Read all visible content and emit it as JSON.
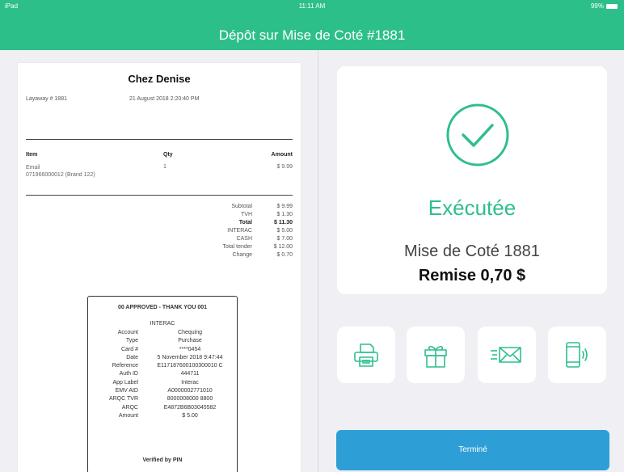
{
  "status_bar": {
    "device": "iPad",
    "time": "11:11 AM",
    "battery": "99%"
  },
  "header": {
    "title": "Dépôt sur Mise de Coté #1881"
  },
  "receipt": {
    "store": "Chez Denise",
    "layaway": "Layaway # 1881",
    "datetime": "21 August 2018 2:20:40 PM",
    "columns": {
      "item": "Item",
      "qty": "Qty",
      "amount": "Amount"
    },
    "item": {
      "name": "Email",
      "sku": "071966000012 (Brand 122)",
      "qty": "1",
      "amount": "$ 9.99"
    },
    "totals": [
      {
        "label": "Subtotal",
        "value": "$ 9.99"
      },
      {
        "label": "TVH",
        "value": "$ 1.30"
      },
      {
        "label": "Total",
        "value": "$ 11.30"
      },
      {
        "label": "INTERAC",
        "value": "$ 5.00"
      },
      {
        "label": "CASH",
        "value": "$ 7.00"
      },
      {
        "label": "Total tender",
        "value": "$ 12.00"
      },
      {
        "label": "Change",
        "value": "$ 0.70"
      }
    ],
    "slip": {
      "title": "00 APPROVED - THANK YOU 001",
      "subtitle": "INTERAC",
      "rows": [
        {
          "k": "Account",
          "v": "Chequing"
        },
        {
          "k": "Type",
          "v": "Purchase"
        },
        {
          "k": "Card #",
          "v": "****0454"
        },
        {
          "k": "Date",
          "v": "5 November 2018 9:47:44"
        },
        {
          "k": "Reference",
          "v": "E117187600100300010 C"
        },
        {
          "k": "Auth ID",
          "v": "444711"
        },
        {
          "k": "App Label",
          "v": "Interac"
        },
        {
          "k": "EMV AID",
          "v": "A0000002771010"
        },
        {
          "k": "ARQC TVR",
          "v": "8000008000 8800"
        },
        {
          "k": "ARQC",
          "v": "E4872B6B03045582"
        },
        {
          "k": "Amount",
          "v": "$ 5.00"
        }
      ],
      "verified": "Verified by PIN"
    }
  },
  "result": {
    "status": "Exécutée",
    "layaway": "Mise de Coté 1881",
    "change": "Remise 0,70 $"
  },
  "actions": [
    {
      "name": "print",
      "icon": "printer-icon"
    },
    {
      "name": "gift",
      "icon": "gift-icon"
    },
    {
      "name": "email",
      "icon": "email-icon"
    },
    {
      "name": "sms",
      "icon": "phone-icon"
    }
  ],
  "done_button": "Terminé",
  "colors": {
    "accent": "#2dbf8a",
    "button": "#2e9fd6"
  }
}
